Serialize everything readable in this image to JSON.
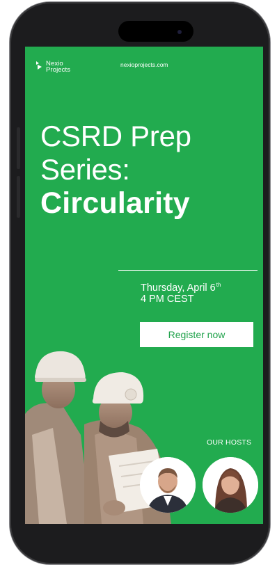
{
  "header": {
    "logo_line1": "Nexio",
    "logo_line2": "Projects",
    "site_url": "nexioprojects.com"
  },
  "headline": {
    "line1": "CSRD Prep",
    "line2": "Series:",
    "topic": "Circularity"
  },
  "event": {
    "date_prefix": "Thursday, April 6",
    "date_suffix": "th",
    "time": "4 PM CEST"
  },
  "cta": {
    "register_label": "Register now"
  },
  "hosts": {
    "label": "OUR HOSTS"
  },
  "colors": {
    "brand_green": "#22ab4f",
    "button_bg": "#ffffff",
    "button_text": "#1fa24a"
  }
}
